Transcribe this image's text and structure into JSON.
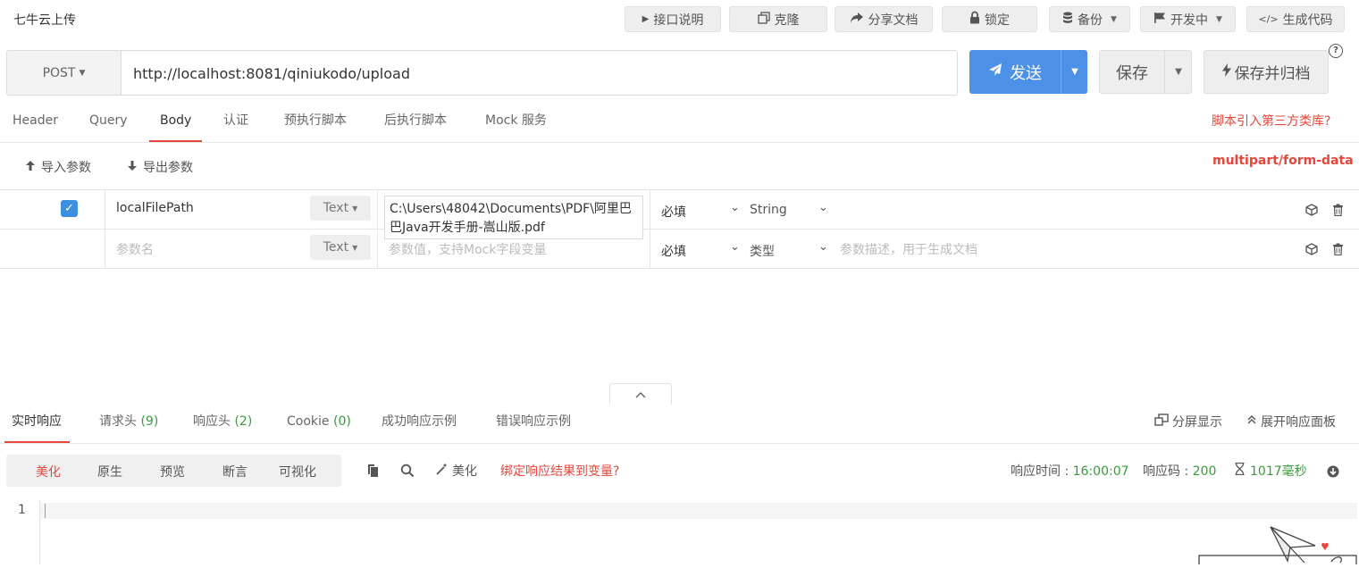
{
  "app": {
    "title": "七牛云上传"
  },
  "toolbar": {
    "doc": "接口说明",
    "clone": "克隆",
    "share": "分享文档",
    "lock": "锁定",
    "backup": "备份",
    "status": "开发中",
    "gencode": "生成代码"
  },
  "request": {
    "method": "POST",
    "url": "http://localhost:8081/qiniukodo/upload",
    "send_label": "发送",
    "save_label": "保存",
    "save_archive_label": "保存并归档"
  },
  "req_tabs": [
    "Header",
    "Query",
    "Body",
    "认证",
    "预执行脚本",
    "后执行脚本",
    "Mock 服务"
  ],
  "req_tab_active": "Body",
  "script_link": "脚本引入第三方类库?",
  "params": {
    "import_label": "导入参数",
    "export_label": "导出参数",
    "content_type": "multipart/form-data",
    "rows": [
      {
        "checked": true,
        "name": "localFilePath",
        "type": "Text",
        "value": "C:\\Users\\48042\\Documents\\PDF\\阿里巴巴Java开发手册-嵩山版.pdf",
        "required": "必填",
        "data_type": "String",
        "description": ""
      }
    ],
    "new_row": {
      "name_placeholder": "参数名",
      "type": "Text",
      "value_placeholder": "参数值，支持Mock字段变量",
      "required": "必填",
      "data_type": "类型",
      "description_placeholder": "参数描述，用于生成文档"
    }
  },
  "response": {
    "tabs": [
      {
        "label": "实时响应",
        "count": ""
      },
      {
        "label": "请求头",
        "count": "(9)"
      },
      {
        "label": "响应头",
        "count": "(2)"
      },
      {
        "label": "Cookie",
        "count": "(0)"
      },
      {
        "label": "成功响应示例",
        "count": ""
      },
      {
        "label": "错误响应示例",
        "count": ""
      }
    ],
    "split_label": "分屏显示",
    "expand_label": "展开响应面板",
    "views": [
      "美化",
      "原生",
      "预览",
      "断言",
      "可视化"
    ],
    "view_active": "美化",
    "beautify_label": "美化",
    "bind_label": "绑定响应结果到变量?",
    "time_label": "响应时间 :",
    "time_value": "16:00:07",
    "code_label": "响应码 :",
    "code_value": "200",
    "duration_value": "1017毫秒",
    "line_number": "1"
  },
  "colors": {
    "accent_red": "#e7473b",
    "primary_blue": "#4d90e8",
    "success_green": "#3a9b3a"
  }
}
